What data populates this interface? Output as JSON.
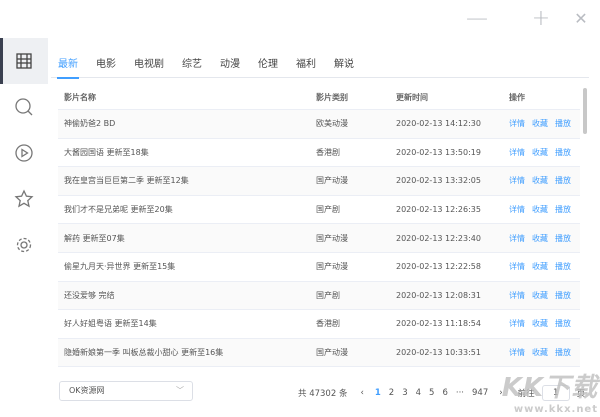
{
  "window": {
    "minimize": "—",
    "maximize": "+",
    "close": "✕"
  },
  "sidebar": {
    "items": [
      {
        "name": "film",
        "active": true
      },
      {
        "name": "search"
      },
      {
        "name": "play"
      },
      {
        "name": "star"
      },
      {
        "name": "settings"
      }
    ]
  },
  "tabs": [
    "最新",
    "电影",
    "电视剧",
    "综艺",
    "动漫",
    "伦理",
    "福利",
    "解说"
  ],
  "table": {
    "headers": {
      "name": "影片名称",
      "category": "影片类别",
      "time": "更新时间",
      "actions": "操作"
    },
    "actions": {
      "detail": "详情",
      "favorite": "收藏",
      "play": "播放"
    },
    "rows": [
      {
        "name": "神偷奶爸2 BD",
        "category": "欧美动漫",
        "time": "2020-02-13 14:12:30"
      },
      {
        "name": "大酱园国语 更新至18集",
        "category": "香港剧",
        "time": "2020-02-13 13:50:19"
      },
      {
        "name": "我在皇宫当巨巨第二季 更新至12集",
        "category": "国产动漫",
        "time": "2020-02-13 13:32:05"
      },
      {
        "name": "我们才不是兄弟呢 更新至20集",
        "category": "国产剧",
        "time": "2020-02-13 12:26:35"
      },
      {
        "name": "解药 更新至07集",
        "category": "国产动漫",
        "time": "2020-02-13 12:23:40"
      },
      {
        "name": "偷星九月天·异世界 更新至15集",
        "category": "国产动漫",
        "time": "2020-02-13 12:22:58"
      },
      {
        "name": "还没爱够 完结",
        "category": "国产剧",
        "time": "2020-02-13 12:08:31"
      },
      {
        "name": "好人好姐粤语 更新至14集",
        "category": "香港剧",
        "time": "2020-02-13 11:18:54"
      },
      {
        "name": "隐婚新娘第一季 叫板总裁小甜心 更新至16集",
        "category": "国产动漫",
        "time": "2020-02-13 10:33:51"
      }
    ]
  },
  "footer": {
    "source": "OK资源网",
    "total": "共 47302 条",
    "prev": "‹",
    "next": "›",
    "pages": [
      "1",
      "2",
      "3",
      "4",
      "5",
      "6",
      "···",
      "947"
    ],
    "goto_label": "前往",
    "goto_value": "1",
    "goto_suffix": "页"
  },
  "watermark": {
    "logo": "KK下载",
    "url": "www.kkx.net"
  },
  "colors": {
    "accent": "#409eff"
  }
}
